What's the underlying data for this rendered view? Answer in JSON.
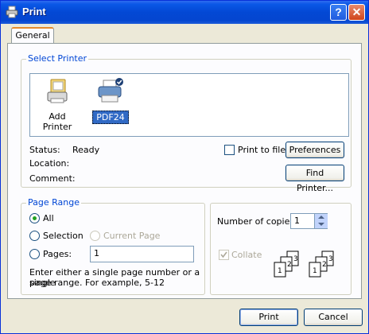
{
  "window": {
    "title": "Print",
    "help_glyph": "?",
    "close_glyph": "✕"
  },
  "tabs": [
    {
      "label": "General"
    }
  ],
  "select_printer": {
    "legend": "Select Printer",
    "printers": [
      {
        "name": "Add Printer",
        "icon": "add-printer-icon",
        "selected": false
      },
      {
        "name": "PDF24",
        "icon": "printer-icon",
        "selected": true
      }
    ],
    "status_label": "Status:",
    "status_value": "Ready",
    "location_label": "Location:",
    "comment_label": "Comment:",
    "print_to_file_label": "Print to file",
    "preferences_label": "Preferences",
    "find_printer_label": "Find Printer..."
  },
  "page_range": {
    "legend": "Page Range",
    "all_label": "All",
    "selection_label": "Selection",
    "current_page_label": "Current Page",
    "pages_label": "Pages:",
    "pages_value": "1",
    "help_text_line1": "Enter either a single page number or a single",
    "help_text_line2": "page range.  For example, 5-12"
  },
  "copies": {
    "label": "Number of copies:",
    "value": "1",
    "collate_label": "Collate",
    "collate_pages": [
      "1",
      "2",
      "3"
    ]
  },
  "footer": {
    "print_label": "Print",
    "cancel_label": "Cancel"
  },
  "colors": {
    "titlebar": "#0348d4",
    "legend": "#0046d5",
    "selection": "#316ac5"
  }
}
